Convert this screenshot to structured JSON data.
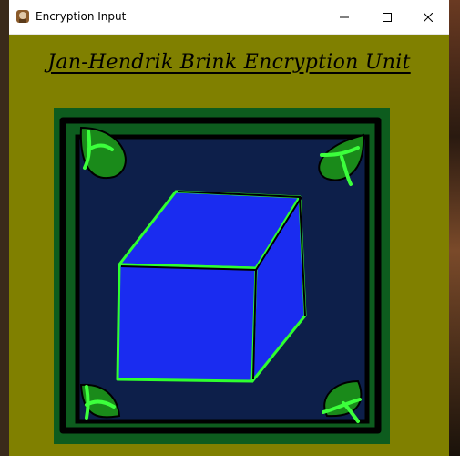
{
  "window": {
    "title": "Encryption Input",
    "app_icon": "app-icon",
    "controls": [
      "minimize-icon",
      "maximize-icon",
      "close-icon"
    ]
  },
  "main": {
    "heading": "Jan-Hendrik Brink Encryption Unit",
    "artwork": "cube-logo"
  },
  "colors": {
    "window_bg": "#808000",
    "frame_outer": "#0d5c1e",
    "frame_inner": "#0d1f4a",
    "cube_fill": "#1a2cf0",
    "cube_outline": "#2fff2f"
  }
}
